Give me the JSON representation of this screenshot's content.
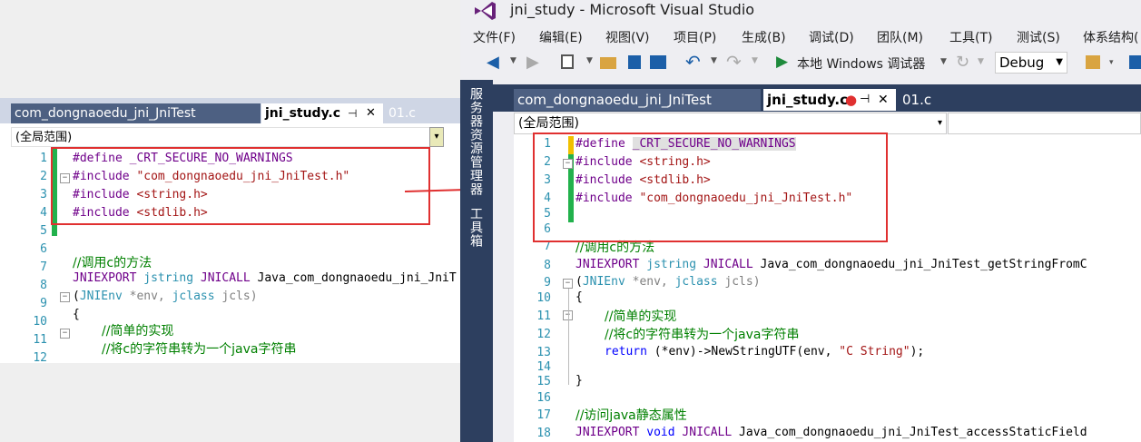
{
  "left": {
    "tabs": [
      "com_dongnaoedu_jni_JniTest",
      "jni_study.c",
      "01.c"
    ],
    "tab_pin": "⊣",
    "tab_close": "✕",
    "scope": "(全局范围)",
    "scope_arrow": "▾",
    "lines": [
      {
        "n": "1"
      },
      {
        "n": "2"
      },
      {
        "n": "3"
      },
      {
        "n": "4"
      },
      {
        "n": "5"
      },
      {
        "n": "6"
      },
      {
        "n": "7"
      },
      {
        "n": "8"
      },
      {
        "n": "9"
      },
      {
        "n": "10"
      },
      {
        "n": "11"
      },
      {
        "n": "12"
      }
    ],
    "code": {
      "l1a": "#define ",
      "l1b": "_CRT_SECURE_NO_WARNINGS",
      "l2a": "#include ",
      "l2b": "\"com_dongnaoedu_jni_JniTest.h\"",
      "l3a": "#include ",
      "l3b": "<string.h>",
      "l4a": "#include ",
      "l4b": "<stdlib.h>",
      "l7": "//调用c的方法",
      "l8a": "JNIEXPORT ",
      "l8b": "jstring ",
      "l8c": "JNICALL ",
      "l8d": "Java_com_dongnaoedu_jni_JniT",
      "l9a": "(",
      "l9b": "JNIEnv ",
      "l9c": "*env, ",
      "l9d": "jclass ",
      "l9e": "jcls)",
      "l10": "{",
      "l11": "//简单的实现",
      "l12": "//将c的字符串转为一个java字符串"
    }
  },
  "vs": {
    "title": "jni_study - Microsoft Visual Studio",
    "menu": [
      "文件(F)",
      "编辑(E)",
      "视图(V)",
      "项目(P)",
      "生成(B)",
      "调试(D)",
      "团队(M)",
      "工具(T)",
      "测试(S)",
      "体系结构("
    ],
    "run_label": "本地 Windows 调试器",
    "config": "Debug",
    "side_panels": [
      "服务器资源管理器",
      "工具箱"
    ],
    "tabs": [
      "com_dongnaoedu_jni_JniTest",
      "jni_study.c",
      "01.c"
    ],
    "tab_pin": "⊣",
    "tab_close": "✕",
    "scope": "(全局范围)",
    "scope_arrow": "▾",
    "lines": [
      "1",
      "2",
      "3",
      "4",
      "5",
      "6",
      "7",
      "8",
      "9",
      "10",
      "11",
      "12",
      "13",
      "14",
      "15",
      "16",
      "17",
      "18"
    ],
    "code": {
      "l1a": "#define ",
      "l1b": "_CRT_SECURE_NO_WARNINGS",
      "l2a": "#include ",
      "l2b": "<string.h>",
      "l3a": "#include ",
      "l3b": "<stdlib.h>",
      "l4a": "#include ",
      "l4b": "\"com_dongnaoedu_jni_JniTest.h\"",
      "l7": "//调用c的方法",
      "l8a": "JNIEXPORT ",
      "l8b": "jstring ",
      "l8c": "JNICALL ",
      "l8d": "Java_com_dongnaoedu_jni_JniTest_getStringFromC",
      "l9a": "(",
      "l9b": "JNIEnv ",
      "l9c": "*env, ",
      "l9d": "jclass ",
      "l9e": "jcls)",
      "l10": "{",
      "l11": "//简单的实现",
      "l12": "//将c的字符串转为一个java字符串",
      "l13a": "return ",
      "l13b": "(*env)->NewStringUTF(env, ",
      "l13c": "\"C String\"",
      "l13d": ");",
      "l15": "}",
      "l17": "//访问java静态属性",
      "l18a": "JNIEXPORT ",
      "l18b": "void ",
      "l18c": "JNICALL ",
      "l18d": "Java_com_dongnaoedu_jni_JniTest_accessStaticField"
    }
  },
  "colors": {
    "highlight_red": "#e03030",
    "change_green": "#22b14c",
    "change_yellow": "#f0c000",
    "vs_purple": "#68217a"
  }
}
